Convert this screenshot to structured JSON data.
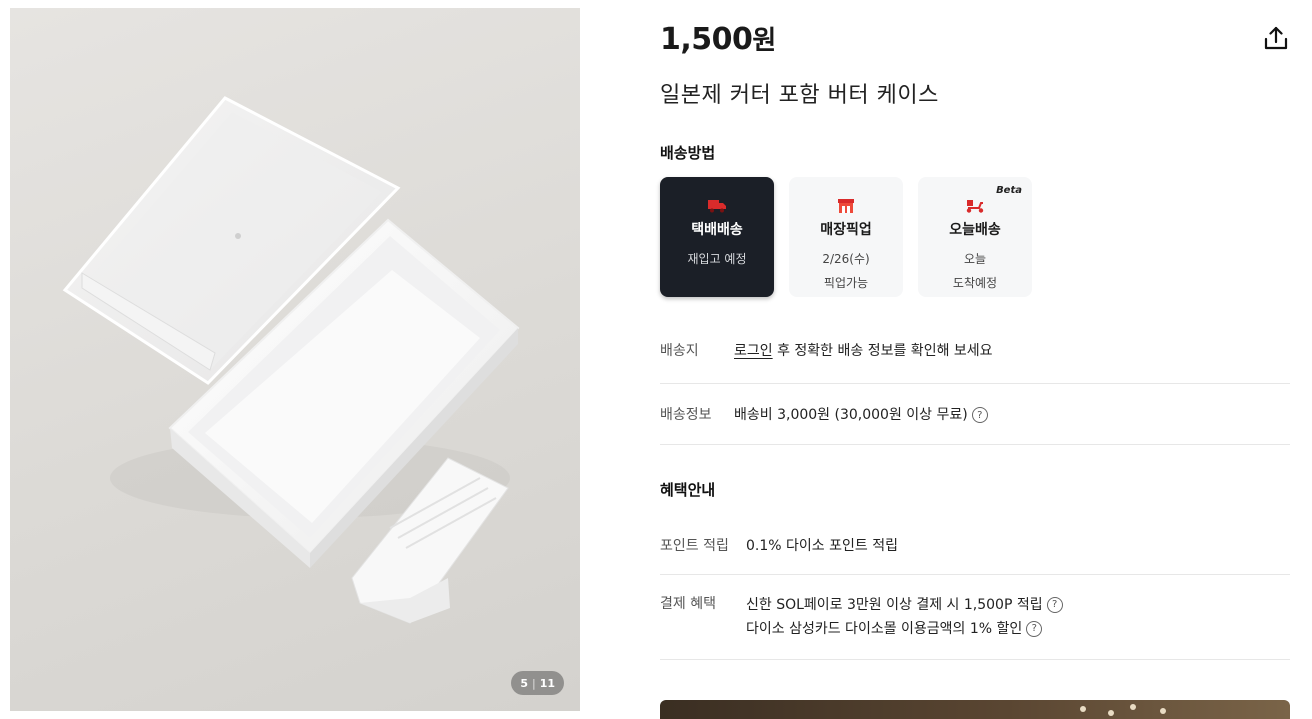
{
  "gallery": {
    "current": "5",
    "separator": "|",
    "total": "11"
  },
  "product": {
    "price_number": "1,500",
    "price_unit": "원",
    "title": "일본제 커터 포함 버터 케이스"
  },
  "shipping": {
    "heading": "배송방법",
    "options": [
      {
        "name": "택배배송",
        "sub1": "재입고 예정",
        "sub2": "",
        "icon": "truck-icon",
        "active": true
      },
      {
        "name": "매장픽업",
        "sub1": "2/26(수)",
        "sub2": "픽업가능",
        "icon": "store-icon",
        "active": false
      },
      {
        "name": "오늘배송",
        "sub1": "오늘",
        "sub2": "도착예정",
        "icon": "scooter-icon",
        "active": false,
        "badge": "Beta"
      }
    ],
    "destination_label": "배송지",
    "destination_link": "로그인",
    "destination_text": " 후 정확한 배송 정보를 확인해 보세요",
    "info_label": "배송정보",
    "info_text": "배송비 3,000원 (30,000원 이상 무료)",
    "help_glyph": "?"
  },
  "benefits": {
    "heading": "혜택안내",
    "points_label": "포인트 적립",
    "points_text": "0.1% 다이소 포인트 적립",
    "payment_label": "결제 혜택",
    "payment_line1": "신한 SOL페이로 3만원 이상 결제 시 1,500P 적립",
    "payment_line2": "다이소 삼성카드 다이소몰 이용금액의 1% 할인"
  },
  "colors": {
    "accent_dark": "#1b1f27",
    "icon_red": "#d92b2b"
  }
}
